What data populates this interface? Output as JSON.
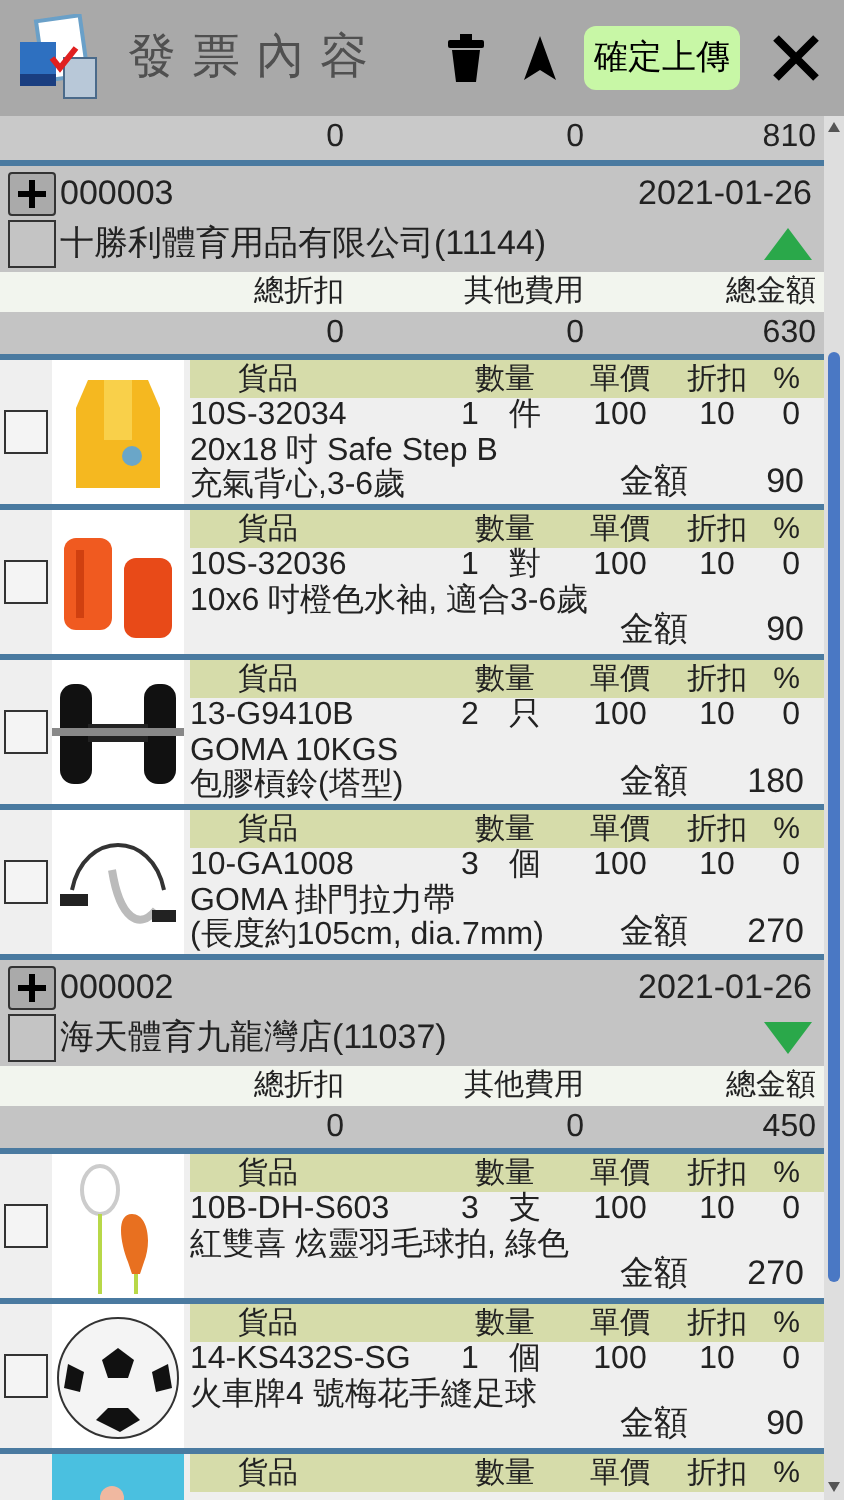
{
  "header": {
    "title": "發票內容",
    "upload_button": "確定上傳"
  },
  "previous_totals": [
    "0",
    "0",
    "810"
  ],
  "invoices": [
    {
      "number": "000003",
      "date": "2021-01-26",
      "customer": "十勝利體育用品有限公司(11144)",
      "checked": false,
      "expanded": true,
      "summary_labels": [
        "總折扣",
        "其他費用",
        "總金額"
      ],
      "summary_values": [
        "0",
        "0",
        "630"
      ],
      "items": [
        {
          "checked": false,
          "labels": [
            "貨品",
            "數量",
            "單價",
            "折扣",
            "%"
          ],
          "code": "10S-32034",
          "qty": "1",
          "unit": "件",
          "price": "100",
          "discount": "10",
          "percent": "0",
          "name_lines": [
            "20x18 吋 Safe Step B",
            "充氣背心,3-6歲"
          ],
          "amount_label": "金額",
          "amount": "90"
        },
        {
          "checked": false,
          "labels": [
            "貨品",
            "數量",
            "單價",
            "折扣",
            "%"
          ],
          "code": "10S-32036",
          "qty": "1",
          "unit": "對",
          "price": "100",
          "discount": "10",
          "percent": "0",
          "name_lines": [
            "10x6 吋橙色水袖, 適合3-6歲"
          ],
          "amount_label": "金額",
          "amount": "90"
        },
        {
          "checked": false,
          "labels": [
            "貨品",
            "數量",
            "單價",
            "折扣",
            "%"
          ],
          "code": "13-G9410B",
          "qty": "2",
          "unit": "只",
          "price": "100",
          "discount": "10",
          "percent": "0",
          "name_lines": [
            "GOMA 10KGS",
            "包膠槓鈴(塔型)"
          ],
          "amount_label": "金額",
          "amount": "180"
        },
        {
          "checked": false,
          "labels": [
            "貨品",
            "數量",
            "單價",
            "折扣",
            "%"
          ],
          "code": "10-GA1008",
          "qty": "3",
          "unit": "個",
          "price": "100",
          "discount": "10",
          "percent": "0",
          "name_lines": [
            "GOMA 掛門拉力帶",
            "(長度約105cm, dia.7mm)"
          ],
          "amount_label": "金額",
          "amount": "270"
        }
      ]
    },
    {
      "number": "000002",
      "date": "2021-01-26",
      "customer": "海天體育九龍灣店(11037)",
      "checked": false,
      "expanded": false,
      "summary_labels": [
        "總折扣",
        "其他費用",
        "總金額"
      ],
      "summary_values": [
        "0",
        "0",
        "450"
      ],
      "items": [
        {
          "checked": false,
          "labels": [
            "貨品",
            "數量",
            "單價",
            "折扣",
            "%"
          ],
          "code": "10B-DH-S603",
          "qty": "3",
          "unit": "支",
          "price": "100",
          "discount": "10",
          "percent": "0",
          "name_lines": [
            "紅雙喜 炫靈羽毛球拍, 綠色"
          ],
          "amount_label": "金額",
          "amount": "270"
        },
        {
          "checked": false,
          "labels": [
            "貨品",
            "數量",
            "單價",
            "折扣",
            "%"
          ],
          "code": "14-KS432S-SG",
          "qty": "1",
          "unit": "個",
          "price": "100",
          "discount": "10",
          "percent": "0",
          "name_lines": [
            "火車牌4 號梅花手縫足球"
          ],
          "amount_label": "金額",
          "amount": "90"
        },
        {
          "labels": [
            "貨品",
            "數量",
            "單價",
            "折扣",
            "%"
          ]
        }
      ]
    }
  ]
}
